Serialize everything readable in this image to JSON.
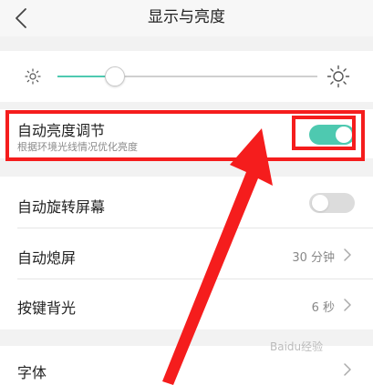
{
  "header": {
    "title": "显示与亮度",
    "back_icon": "chevron-left-icon"
  },
  "brightness": {
    "level": 0.22,
    "low_icon": "sun-small-icon",
    "high_icon": "sun-large-icon",
    "accent_color": "#4ec9b0"
  },
  "auto_brightness": {
    "label": "自动亮度调节",
    "subtitle": "根据环境光线情况优化亮度",
    "enabled": true
  },
  "rows": {
    "auto_rotate": {
      "label": "自动旋转屏幕",
      "enabled": false
    },
    "screen_timeout": {
      "label": "自动熄屏",
      "value": "30 分钟"
    },
    "key_backlight": {
      "label": "按键背光",
      "value": "6 秒"
    },
    "font": {
      "label": "字体"
    }
  },
  "annotation": {
    "color": "#f51d1d"
  },
  "watermark": {
    "text": "Baidu经验"
  }
}
